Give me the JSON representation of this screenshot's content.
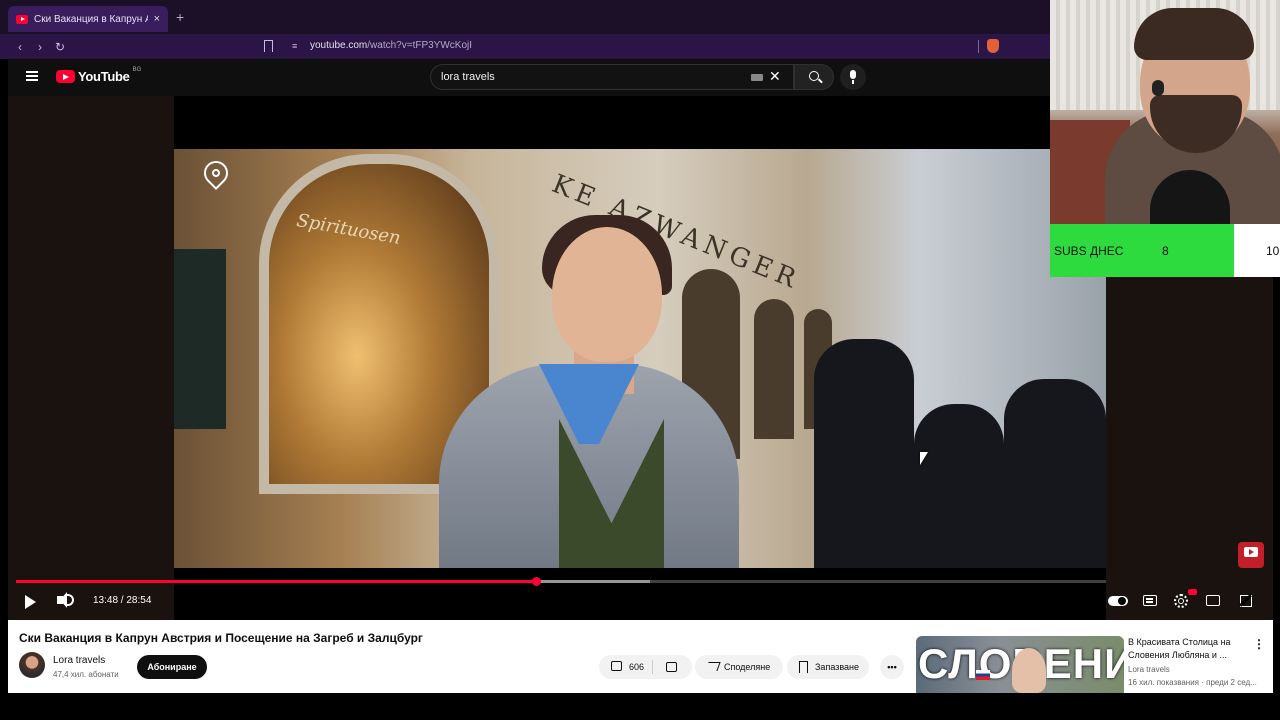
{
  "browser": {
    "tab_title": "Ски Ваканция в Капрун Австрия",
    "tab_close": "×",
    "new_tab": "+",
    "url_host": "youtube.com",
    "url_path": "/watch?v=tFP3YWcKojI",
    "nav_back": "‹",
    "nav_forward": "›",
    "nav_reload": "↻"
  },
  "youtube": {
    "logo_text": "YouTube",
    "region": "BG",
    "search_value": "lora travels",
    "clear_symbol": "✕"
  },
  "player": {
    "time_current": "13:48",
    "time_total": "28:54",
    "time_display": "13:48 / 28:54",
    "progress_fraction": 0.4775,
    "buffer_fraction": 0.5814,
    "shop_sign": "Spirituosen",
    "facade_text": "KE AZWANGER"
  },
  "video": {
    "title": "Ски Ваканция в Капрун Австрия и Посещение на Загреб и Залцбург",
    "channel_name": "Lora travels",
    "subscriber_count": "47,4 хил. абонати",
    "subscribe_label": "Абониране",
    "like_count": "606",
    "share_label": "Споделяне",
    "save_label": "Запазване",
    "more_label": "•••"
  },
  "recommendation": {
    "thumb_text": "СЛОВЕНИЯ",
    "title": "В Красивата Столица на Словения Любляна и ...",
    "channel": "Lora travels",
    "meta": "16 хил. показвания · преди 2 сед...",
    "menu": "⋮"
  },
  "stream_overlay": {
    "subs_label": "SUBS ДНЕС",
    "subs_count": "8",
    "subs_goal": "10",
    "subs_fraction": 0.8,
    "accent_color": "#2ddb3e"
  },
  "colors": {
    "browser_frame": "#2b1446",
    "youtube_red": "#ff0033",
    "masthead": "#0f0f0f"
  }
}
